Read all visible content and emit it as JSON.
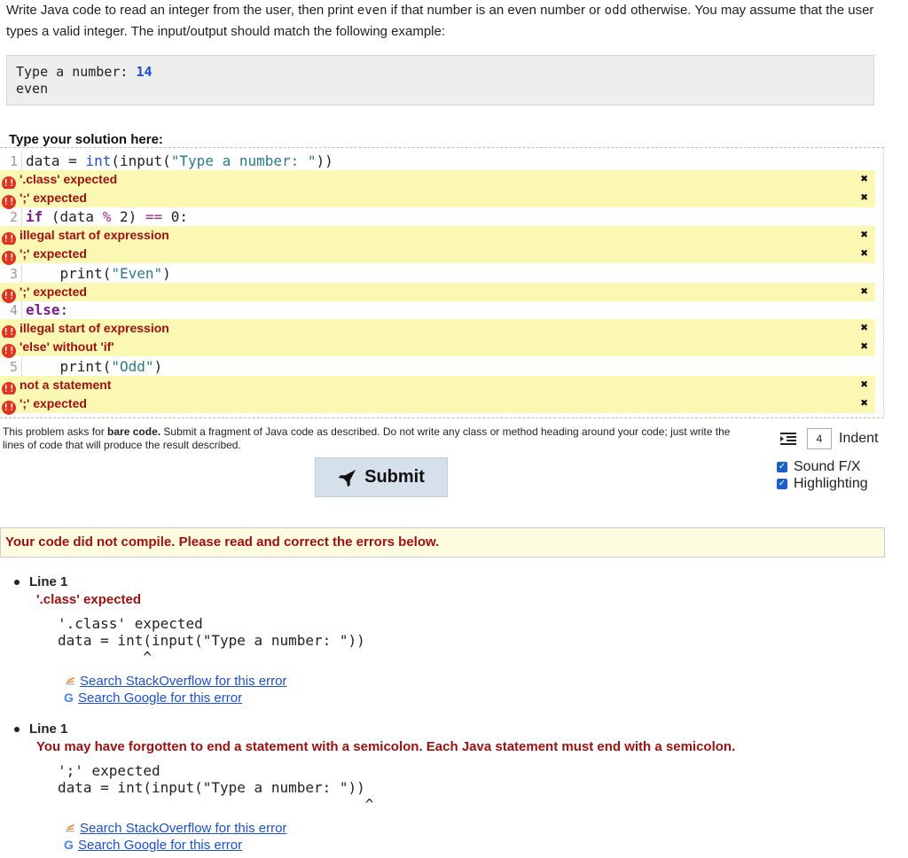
{
  "prompt": {
    "part1": "Write Java code to read an integer from the user, then print ",
    "even_word": "even",
    "part2": " if that number is an even number or ",
    "odd_word": "odd",
    "part3": " otherwise. You may assume that the user types a valid integer. The input/output should match the following example:"
  },
  "example": {
    "prompt_text": "Type a number: ",
    "user_input": "14",
    "output": "even"
  },
  "solution_label": "Type your solution here:",
  "editor": {
    "lines": [
      {
        "num": "1",
        "tokens": [
          [
            "",
            "data = "
          ],
          [
            "kw-blue",
            "int"
          ],
          [
            "",
            "(input("
          ],
          [
            "str",
            "\"Type a number: \""
          ],
          [
            "",
            "))"
          ]
        ]
      },
      {
        "num": "2",
        "tokens": [
          [
            "kw-purple",
            "if"
          ],
          [
            "",
            " (data "
          ],
          [
            "op",
            "%"
          ],
          [
            "",
            " 2) "
          ],
          [
            "op",
            "=="
          ],
          [
            "",
            " 0:"
          ]
        ]
      },
      {
        "num": "3",
        "tokens": [
          [
            "",
            "    print("
          ],
          [
            "str",
            "\"Even\""
          ],
          [
            "",
            ")"
          ]
        ]
      },
      {
        "num": "4",
        "tokens": [
          [
            "kw-purple",
            "else"
          ],
          [
            "",
            ":"
          ]
        ]
      },
      {
        "num": "5",
        "tokens": [
          [
            "",
            "    print("
          ],
          [
            "str",
            "\"Odd\""
          ],
          [
            "",
            ")"
          ]
        ]
      }
    ],
    "errors": [
      {
        "after_line": "1",
        "text": "'.class' expected"
      },
      {
        "after_line": "1",
        "text": "';' expected"
      },
      {
        "after_line": "2",
        "text": "illegal start of expression"
      },
      {
        "after_line": "2",
        "text": "';' expected"
      },
      {
        "after_line": "3",
        "text": "';' expected"
      },
      {
        "after_line": "4",
        "text": "illegal start of expression"
      },
      {
        "after_line": "4",
        "text": "'else' without 'if'"
      },
      {
        "after_line": "5",
        "text": "not a statement"
      },
      {
        "after_line": "5",
        "text": "';' expected"
      }
    ],
    "error_icon": "!!",
    "dismiss_icon": "✖"
  },
  "note": {
    "prefix": "This problem asks for ",
    "bold": "bare code.",
    "suffix": " Submit a fragment of Java code as described. Do not write any class or method heading around your code; just write the lines of code that will produce the result described."
  },
  "submit_label": "Submit",
  "indent": {
    "value": "4",
    "label": "Indent"
  },
  "options": [
    {
      "label": "Sound F/X",
      "checked": true
    },
    {
      "label": "Highlighting",
      "checked": true
    }
  ],
  "compile_message": "Your code did not compile. Please read and correct the errors below.",
  "results": [
    {
      "line": "Line 1",
      "message": "'.class' expected",
      "code": "'.class' expected\ndata = int(input(\"Type a number: \"))\n          ^",
      "so_link": "Search StackOverflow for this error",
      "google_link": "Search Google for this error"
    },
    {
      "line": "Line 1",
      "message": "You may have forgotten to end a statement with a semicolon. Each Java statement must end with a semicolon.",
      "code": "';' expected\ndata = int(input(\"Type a number: \"))\n                                    ^",
      "so_link": "Search StackOverflow for this error",
      "google_link": "Search Google for this error"
    }
  ]
}
